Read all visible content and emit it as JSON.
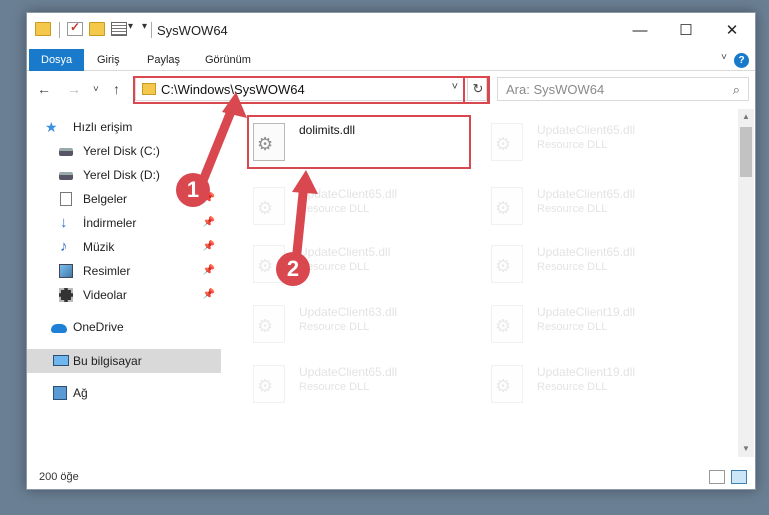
{
  "window": {
    "title": "SysWOW64",
    "controls": {
      "minimize": "—",
      "maximize": "☐",
      "close": "✕"
    }
  },
  "ribbon": {
    "tabs": [
      "Dosya",
      "Giriş",
      "Paylaş",
      "Görünüm"
    ],
    "help": "?"
  },
  "nav": {
    "back": "←",
    "forward": "→",
    "recent": "˅",
    "up": "↑",
    "address": "C:\\Windows\\SysWOW64",
    "refresh": "↻",
    "search_placeholder": "Ara: SysWOW64",
    "search_icon": "⌕"
  },
  "sidebar": {
    "items": [
      {
        "label": "Hızlı erişim",
        "icon": "star-icon"
      },
      {
        "label": "Yerel Disk (C:)",
        "icon": "disk-icon",
        "pinned": true
      },
      {
        "label": "Yerel Disk (D:)",
        "icon": "disk-icon",
        "pinned": true
      },
      {
        "label": "Belgeler",
        "icon": "document-icon",
        "pinned": true
      },
      {
        "label": "İndirmeler",
        "icon": "download-icon",
        "pinned": true
      },
      {
        "label": "Müzik",
        "icon": "music-icon",
        "pinned": true
      },
      {
        "label": "Resimler",
        "icon": "pictures-icon",
        "pinned": true
      },
      {
        "label": "Videolar",
        "icon": "video-icon",
        "pinned": true
      },
      {
        "label": "OneDrive",
        "icon": "cloud-icon"
      },
      {
        "label": "Bu bilgisayar",
        "icon": "computer-icon",
        "selected": true
      },
      {
        "label": "Ağ",
        "icon": "network-icon"
      }
    ]
  },
  "files": [
    {
      "name": "dolimits.dll",
      "type": ""
    },
    {
      "name": "UpdateClient65.dll",
      "type": "Resource DLL"
    },
    {
      "name": "UpdateClient65.dll",
      "type": "Resource DLL"
    },
    {
      "name": "UpdateClient65.dll",
      "type": "Resource DLL"
    },
    {
      "name": "UpdateClient5.dll",
      "type": "Resource DLL"
    },
    {
      "name": "UpdateClient65.dll",
      "type": "Resource DLL"
    },
    {
      "name": "UpdateClient63.dll",
      "type": "Resource DLL"
    },
    {
      "name": "UpdateClient19.dll",
      "type": "Resource DLL"
    },
    {
      "name": "UpdateClient65.dll",
      "type": "Resource DLL"
    },
    {
      "name": "UpdateClient19.dll",
      "type": "Resource DLL"
    }
  ],
  "status": {
    "item_count": "200 öğe"
  },
  "callouts": [
    "1",
    "2"
  ],
  "colors": {
    "accent": "#1979ca",
    "highlight": "#d9474f",
    "selected": "#d9d9d9"
  }
}
